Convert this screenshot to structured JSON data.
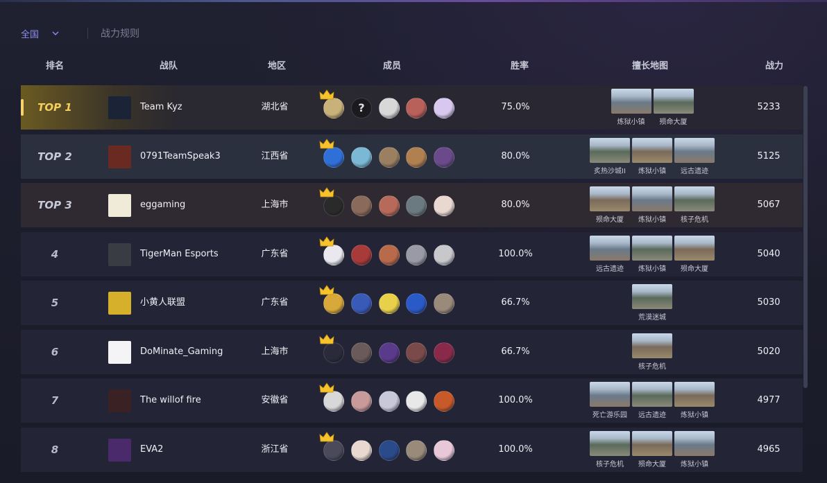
{
  "filter": {
    "region_selected": "全国",
    "rules_link": "战力规则"
  },
  "headers": [
    "排名",
    "战队",
    "地区",
    "成员",
    "胜率",
    "擅长地图",
    "战力"
  ],
  "colors": {
    "accent": "#8f8cf2",
    "gold": "#f4cf5d",
    "background": "#1c1d2b"
  },
  "rows": [
    {
      "rank": "TOP 1",
      "team": "Team Kyz",
      "region": "湖北省",
      "winrate": "75.0%",
      "maps": [
        "炼狱小镇",
        "殒命大厦"
      ],
      "power": "5233",
      "logo_color": "#1b2436",
      "avatars": [
        "#c9b27a",
        "?",
        "#d8d8d8",
        "#b8605a",
        "#d8c8ef"
      ]
    },
    {
      "rank": "TOP 2",
      "team": "0791TeamSpeak3",
      "region": "江西省",
      "winrate": "80.0%",
      "maps": [
        "炙热沙城II",
        "炼狱小镇",
        "远古遗迹"
      ],
      "power": "5125",
      "logo_color": "#6a2a22",
      "avatars": [
        "#2f6fd8",
        "#7ab8d6",
        "#9a8060",
        "#b08050",
        "#6a4a8a"
      ]
    },
    {
      "rank": "TOP 3",
      "team": "eggaming",
      "region": "上海市",
      "winrate": "80.0%",
      "maps": [
        "殒命大厦",
        "炼狱小镇",
        "核子危机"
      ],
      "power": "5067",
      "logo_color": "#f0ead8",
      "avatars": [
        "#2a2a2a",
        "#8a6a5a",
        "#b86a5a",
        "#6a7a80",
        "#e8d8d0"
      ]
    },
    {
      "rank": "4",
      "team": "TigerMan Esports",
      "region": "广东省",
      "winrate": "100.0%",
      "maps": [
        "远古遗迹",
        "炼狱小镇",
        "殒命大厦"
      ],
      "power": "5040",
      "logo_color": "#3a3c44",
      "avatars": [
        "#e8e8ee",
        "#a83a3a",
        "#b86a4a",
        "#9a9aa6",
        "#c8c8cc"
      ]
    },
    {
      "rank": "5",
      "team": "小黄人联盟",
      "region": "广东省",
      "winrate": "66.7%",
      "maps": [
        "荒漠迷城"
      ],
      "power": "5030",
      "logo_color": "#d6b02a",
      "avatars": [
        "#d8a83a",
        "#3a5ab8",
        "#e8d04a",
        "#2a5ac8",
        "#9a8a7a"
      ]
    },
    {
      "rank": "6",
      "team": "DoMinate_Gaming",
      "region": "上海市",
      "winrate": "66.7%",
      "maps": [
        "核子危机"
      ],
      "power": "5020",
      "logo_color": "#f4f4f6",
      "avatars": [
        "#2a2a3a",
        "#6a5a5a",
        "#5a3a8a",
        "#7a4a4a",
        "#8a2a4a"
      ]
    },
    {
      "rank": "7",
      "team": "The willof fire",
      "region": "安徽省",
      "winrate": "100.0%",
      "maps": [
        "死亡游乐园",
        "远古遗迹",
        "炼狱小镇"
      ],
      "power": "4977",
      "logo_color": "#3a2224",
      "avatars": [
        "#d8d8d8",
        "#c89a9a",
        "#c8c8d8",
        "#e8e8e8",
        "#c85a2a"
      ]
    },
    {
      "rank": "8",
      "team": "EVA2",
      "region": "浙江省",
      "winrate": "100.0%",
      "maps": [
        "核子危机",
        "殒命大厦",
        "炼狱小镇"
      ],
      "power": "4965",
      "logo_color": "#4a2a6a",
      "avatars": [
        "#4a4a5a",
        "#e8d8d0",
        "#2a4a8a",
        "#9a8a7a",
        "#e8c8d8"
      ]
    }
  ]
}
